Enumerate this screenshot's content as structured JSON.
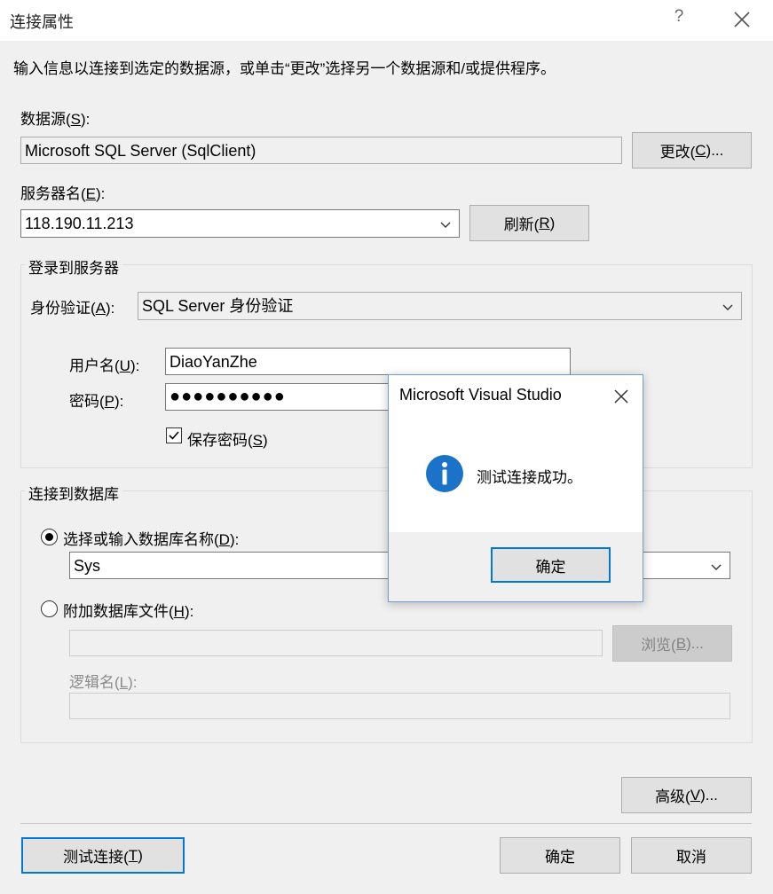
{
  "dialog": {
    "title": "连接属性",
    "help_glyph": "?",
    "description": "输入信息以连接到选定的数据源，或单击“更改”选择另一个数据源和/或提供程序。"
  },
  "datasource": {
    "label": "数据源(",
    "label_key": "S",
    "label_end": "):",
    "value": "Microsoft SQL Server (SqlClient)",
    "change_button": "更改(",
    "change_key": "C",
    "change_end": ")..."
  },
  "server": {
    "label": "服务器名(",
    "label_key": "E",
    "label_end": "):",
    "value": "118.190.11.213",
    "refresh_button": "刷新(",
    "refresh_key": "R",
    "refresh_end": ")"
  },
  "login": {
    "group_title": "登录到服务器",
    "auth_label": "身份验证(",
    "auth_key": "A",
    "auth_end": "):",
    "auth_value": "SQL Server 身份验证",
    "user_label": "用户名(",
    "user_key": "U",
    "user_end": "):",
    "user_value": "DiaoYanZhe",
    "password_label": "密码(",
    "password_key": "P",
    "password_end": "):",
    "password_mask": "●●●●●●●●●●",
    "save_password_label": "保存密码(",
    "save_password_key": "S",
    "save_password_end": ")",
    "save_password_checked": true
  },
  "database": {
    "group_title": "连接到数据库",
    "select_label": "选择或输入数据库名称(",
    "select_key": "D",
    "select_end": "):",
    "select_value": "Sys",
    "attach_label": "附加数据库文件(",
    "attach_key": "H",
    "attach_end": "):",
    "attach_value": "",
    "browse_button": "浏览(",
    "browse_key": "B",
    "browse_end": ")...",
    "logical_label": "逻辑名(",
    "logical_key": "L",
    "logical_end": "):",
    "logical_value": ""
  },
  "footer": {
    "advanced_button": "高级(",
    "advanced_key": "V",
    "advanced_end": ")...",
    "test_button": "测试连接(",
    "test_key": "T",
    "test_end": ")",
    "ok_button": "确定",
    "cancel_button": "取消"
  },
  "messagebox": {
    "title": "Microsoft Visual Studio",
    "icon": "info-icon",
    "message": "测试连接成功。",
    "ok_button": "确定"
  },
  "colors": {
    "accent": "#0078d7",
    "info_icon": "#1a73c8"
  }
}
